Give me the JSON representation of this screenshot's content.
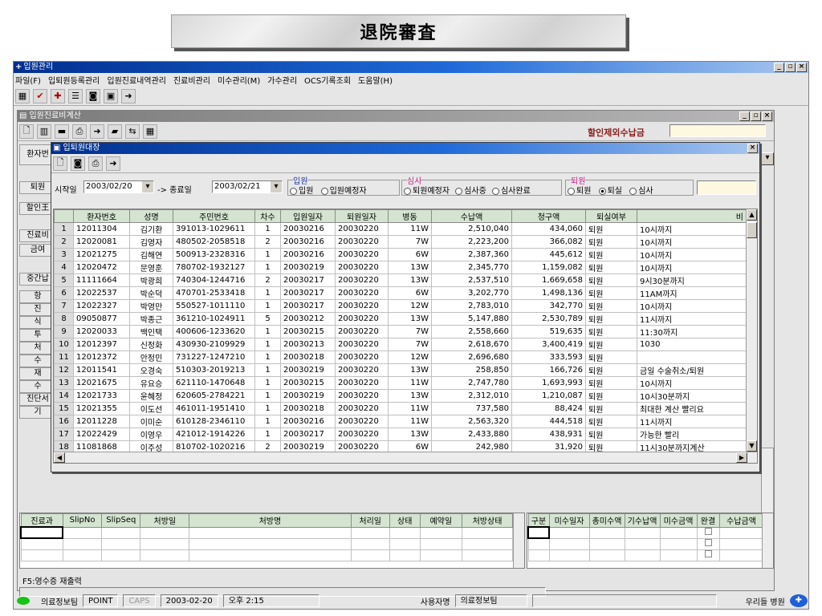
{
  "banner": {
    "title": "退院審査"
  },
  "app": {
    "title": "입원관리",
    "menu": [
      "파일(F)",
      "입퇴원등록관리",
      "입원진료내역관리",
      "진료비관리",
      "미수관리(M)",
      "가수관리",
      "OCS기록조회",
      "도움말(H)"
    ]
  },
  "inner": {
    "title": "입원진료비계산",
    "discount_label": "할인제외수납금",
    "left_labels": [
      "환자번",
      "퇴원",
      "할인王",
      "진료비",
      "금여",
      "중간납",
      "항",
      "진",
      "식",
      "투",
      "처",
      "수",
      "재",
      "수",
      "진단서",
      "기"
    ]
  },
  "dialog": {
    "title": "입퇴원대장",
    "start_label": "시작일",
    "start_date": "2003/02/20",
    "arrow": "-> 종료일",
    "end_date": "2003/02/21",
    "group_inpatient": "입원",
    "group_review": "심사",
    "group_discharge": "퇴원",
    "opt_inpatient": "입원",
    "opt_planned": "입원예정자",
    "opt_discharge_planned": "퇴원예정자",
    "opt_reviewing": "심사중",
    "opt_review_done": "심사완료",
    "opt_discharged": "퇴원",
    "opt_ward": "퇴실",
    "opt_review": "심사",
    "columns": [
      "환자번호",
      "성명",
      "주민번호",
      "차수",
      "입원일자",
      "퇴원일자",
      "병동",
      "수납액",
      "청구액",
      "퇴실여부",
      "비"
    ],
    "rows": [
      [
        "1",
        "12011304",
        "김기환",
        "391013-1029611",
        "1",
        "20030216",
        "20030220",
        "11W",
        "2,510,040",
        "434,060",
        "퇴원",
        "10시까지"
      ],
      [
        "2",
        "12020081",
        "김영자",
        "480502-2058518",
        "2",
        "20030216",
        "20030220",
        "7W",
        "2,223,200",
        "366,082",
        "퇴원",
        "10시까지"
      ],
      [
        "3",
        "12021275",
        "김해연",
        "500913-2328316",
        "1",
        "20030216",
        "20030220",
        "6W",
        "2,387,360",
        "445,612",
        "퇴원",
        "10시까지"
      ],
      [
        "4",
        "12020472",
        "문영훈",
        "780702-1932127",
        "1",
        "20030219",
        "20030220",
        "13W",
        "2,345,770",
        "1,159,082",
        "퇴원",
        "10시까지"
      ],
      [
        "5",
        "11111664",
        "박광희",
        "740304-1244716",
        "2",
        "20030217",
        "20030220",
        "13W",
        "2,537,510",
        "1,669,658",
        "퇴원",
        "9시30분까지"
      ],
      [
        "6",
        "12022537",
        "박순덕",
        "470701-2533418",
        "1",
        "20030217",
        "20030220",
        "6W",
        "3,202,770",
        "1,498,136",
        "퇴원",
        "11AM까지"
      ],
      [
        "7",
        "12022327",
        "박영만",
        "550527-1011110",
        "1",
        "20030217",
        "20030220",
        "12W",
        "2,783,010",
        "342,770",
        "퇴원",
        "10시까지"
      ],
      [
        "8",
        "09050877",
        "박종근",
        "361210-1024911",
        "5",
        "20030212",
        "20030220",
        "13W",
        "5,147,880",
        "2,530,789",
        "퇴원",
        "11시까지"
      ],
      [
        "9",
        "12020033",
        "백인택",
        "400606-1233620",
        "1",
        "20030215",
        "20030220",
        "7W",
        "2,558,660",
        "519,635",
        "퇴원",
        "11:30까지"
      ],
      [
        "10",
        "12012397",
        "신정화",
        "430930-2109929",
        "1",
        "20030213",
        "20030220",
        "7W",
        "2,618,670",
        "3,400,419",
        "퇴원",
        "1030"
      ],
      [
        "11",
        "12012372",
        "안정민",
        "731227-1247210",
        "1",
        "20030218",
        "20030220",
        "12W",
        "2,696,680",
        "333,593",
        "퇴원",
        ""
      ],
      [
        "12",
        "12011541",
        "오경숙",
        "510303-2019213",
        "1",
        "20030219",
        "20030220",
        "13W",
        "258,850",
        "166,726",
        "퇴원",
        "금일 수술취소/퇴원"
      ],
      [
        "13",
        "12021675",
        "유요승",
        "621110-1470648",
        "1",
        "20030215",
        "20030220",
        "11W",
        "2,747,780",
        "1,693,993",
        "퇴원",
        "10시까지"
      ],
      [
        "14",
        "12021733",
        "윤혜정",
        "620605-2784221",
        "1",
        "20030219",
        "20030220",
        "13W",
        "2,312,010",
        "1,210,087",
        "퇴원",
        "10시30분까지"
      ],
      [
        "15",
        "12021355",
        "이도선",
        "461011-1951410",
        "1",
        "20030218",
        "20030220",
        "11W",
        "737,580",
        "88,424",
        "퇴원",
        "최대한 계산 빨리요"
      ],
      [
        "16",
        "12011228",
        "이미순",
        "610128-2346110",
        "1",
        "20030216",
        "20030220",
        "11W",
        "2,563,320",
        "444,518",
        "퇴원",
        "11시까지"
      ],
      [
        "17",
        "12022429",
        "이영우",
        "421012-1914226",
        "1",
        "20030217",
        "20030220",
        "13W",
        "2,433,880",
        "438,931",
        "퇴원",
        "가능한 빨리"
      ],
      [
        "18",
        "11081868",
        "이주성",
        "810702-1020216",
        "2",
        "20030219",
        "20030220",
        "6W",
        "242,980",
        "31,920",
        "퇴원",
        "11시30분까지계산"
      ]
    ]
  },
  "lower": {
    "columns_left": [
      "진료과",
      "SlipNo",
      "SlipSeq",
      "처방일",
      "처방명",
      "처리일",
      "상태",
      "예약일",
      "처방상태"
    ],
    "columns_right": [
      "구분",
      "미수일자",
      "총미수액",
      "기수납액",
      "미수금액",
      "완결",
      "수납금액"
    ],
    "hint": "F5:영수증 재출력"
  },
  "status": {
    "user": "의료정보팀",
    "point": "POINT",
    "caps": "CAPS",
    "date": "2003-02-20",
    "time": "오후 2:15",
    "user_label": "사용자명",
    "user_value": "의료정보팀",
    "hospital": "우리들 병원"
  }
}
